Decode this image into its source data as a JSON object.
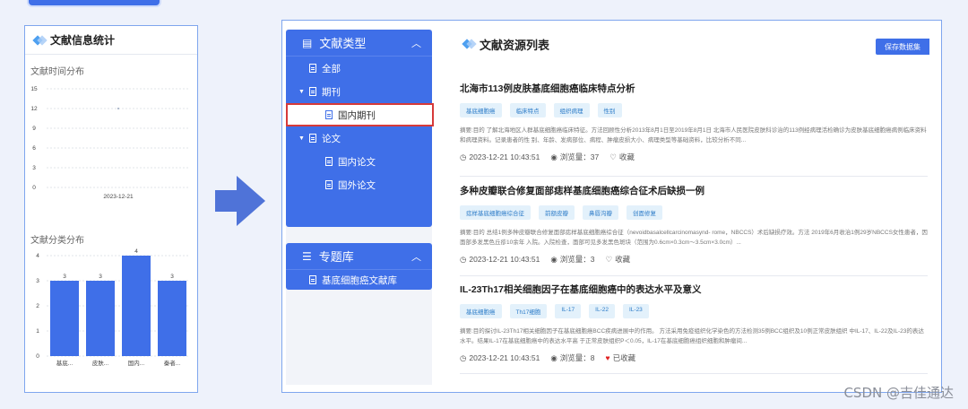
{
  "stats": {
    "title": "文献信息统计",
    "time_dist_label": "文献时间分布",
    "category_dist_label": "文献分类分布"
  },
  "chart_data": [
    {
      "type": "scatter",
      "title": "文献时间分布",
      "x": [
        "2023-12-21"
      ],
      "series": [
        {
          "values": [
            12
          ]
        }
      ],
      "ylim": [
        0,
        15
      ],
      "yticks": [
        0,
        3,
        6,
        9,
        12,
        15
      ],
      "grid": true
    },
    {
      "type": "bar",
      "title": "文献分类分布",
      "categories": [
        "基底...",
        "皮肤...",
        "国内...",
        "秦者..."
      ],
      "values": [
        3,
        3,
        4,
        3
      ],
      "ylim": [
        0,
        4
      ],
      "yticks": [
        0,
        1,
        2,
        3,
        4
      ],
      "bar_color": "#3f6fe8"
    }
  ],
  "nav": {
    "doc_type": {
      "label": "文献类型",
      "items": [
        {
          "label": "全部"
        },
        {
          "label": "期刊"
        },
        {
          "label": "国内期刊"
        },
        {
          "label": "论文"
        },
        {
          "label": "国内论文"
        },
        {
          "label": "国外论文"
        }
      ]
    },
    "library": {
      "label": "专题库",
      "items": [
        {
          "label": "基底细胞癌文献库"
        }
      ]
    }
  },
  "content": {
    "title": "文献资源列表",
    "save_label": "保存数据集",
    "articles": [
      {
        "title": "北海市113例皮肤基底细胞癌临床特点分析",
        "tags": [
          "基底细胞癌",
          "临床特点",
          "组织病理",
          "性别"
        ],
        "abstract": "摘要:目的 了解北海地区人群基底细胞癌临床特征。方法回顾性分析2013年8月1日至2019年8月1日 北海市人民医院皮肤科诊治的113例经病理活检确诊为皮肤基底细胞癌病例临床资料和病理资料。记录患者的性 别、年龄、发病部位、病程、肿瘤皮损大小、病理类型等基础资料，比较分析不同...",
        "date": "2023-12-21 10:43:51",
        "views": "浏览量：37",
        "fav": "收藏",
        "favorited": false
      },
      {
        "title": "多种皮瓣联合修复面部痣样基底细胞癌综合征术后缺损一例",
        "tags": [
          "痣样基底细胞癌综合征",
          "前额皮瓣",
          "鼻唇沟瓣",
          "创面修复"
        ],
        "abstract": "摘要:目的 总结1例多种皮瓣联合修复面部痣样基底细胞癌综合征（nevoidbasalcellcarcinomasynd- rome，NBCCS）术后缺损疗效。方法 2019年6月收治1例29岁NBCCS女性患者，因面部多发黑色丘疹10余年 入院。入院检查，面部可见多发黑色斑块（范围为0.6cm×0.3cm～3.5cm×3.0cm）...",
        "date": "2023-12-21 10:43:51",
        "views": "浏览量：3",
        "fav": "收藏",
        "favorited": false
      },
      {
        "title": "IL-23Th17相关细胞因子在基底细胞癌中的表达水平及意义",
        "tags": [
          "基底细胞癌",
          "Th17细胞",
          "IL-17",
          "IL-22",
          "IL-23"
        ],
        "abstract": "摘要:目的探讨IL-23Th17相关细胞因子在基底细胞癌BCC疾病进展中的作用。 方法采用免疫组织化学染色的方法检测35例BCC组织及10例正常皮肤组织 中IL-17、IL-22及IL-23的表达水平。结果IL-17在基底细胞癌中的表达水平高 于正常皮肤组织P＜0.05，IL-17在基底细胞癌组织细胞和肿瘤间...",
        "date": "2023-12-21 10:43:51",
        "views": "浏览量：8",
        "fav": "已收藏",
        "favorited": true
      }
    ]
  },
  "watermark": "CSDN @吉佳通达",
  "colors": {
    "accent": "#3f6fe8",
    "highlight_border": "#d63a3a",
    "fav": "#e02020"
  }
}
